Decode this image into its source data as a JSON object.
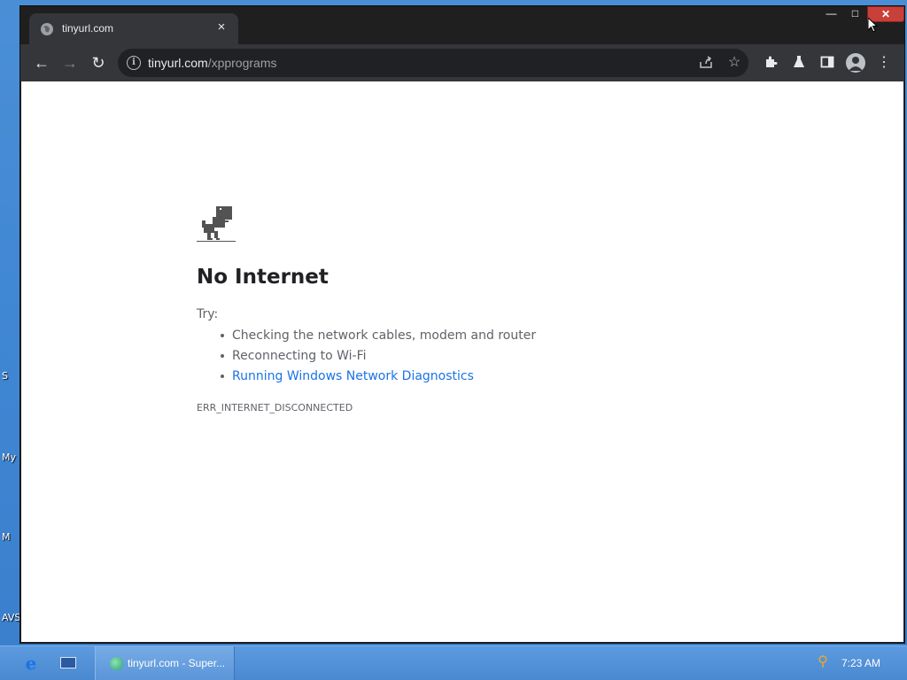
{
  "desktop": {
    "labels": [
      "S",
      "My",
      "M",
      "AVS"
    ]
  },
  "browser": {
    "tab": {
      "title": "tinyurl.com",
      "close_glyph": "×",
      "favicon": "globe-icon"
    },
    "window_controls": {
      "minimize": "—",
      "maximize": "□",
      "close": "✕"
    },
    "nav": {
      "back": "←",
      "forward": "→",
      "reload": "↻"
    },
    "omnibox": {
      "host": "tinyurl.com",
      "path": "/xpprograms",
      "info_icon": "i"
    },
    "toolbar_icons": [
      "share-icon",
      "star-icon",
      "extensions-icon",
      "labs-icon",
      "side-panel-icon",
      "profile-icon",
      "menu-icon"
    ]
  },
  "page": {
    "heading": "No Internet",
    "try_label": "Try:",
    "suggestions": [
      "Checking the network cables, modem and router",
      "Reconnecting to Wi-Fi",
      "Running Windows Network Diagnostics"
    ],
    "error_code": "ERR_INTERNET_DISCONNECTED"
  },
  "taskbar": {
    "task_label": "tinyurl.com - Super...",
    "clock": "7:23 AM"
  },
  "colors": {
    "link": "#1a73e8",
    "chrome_dark": "#35363a",
    "close_red": "#c8403a"
  }
}
